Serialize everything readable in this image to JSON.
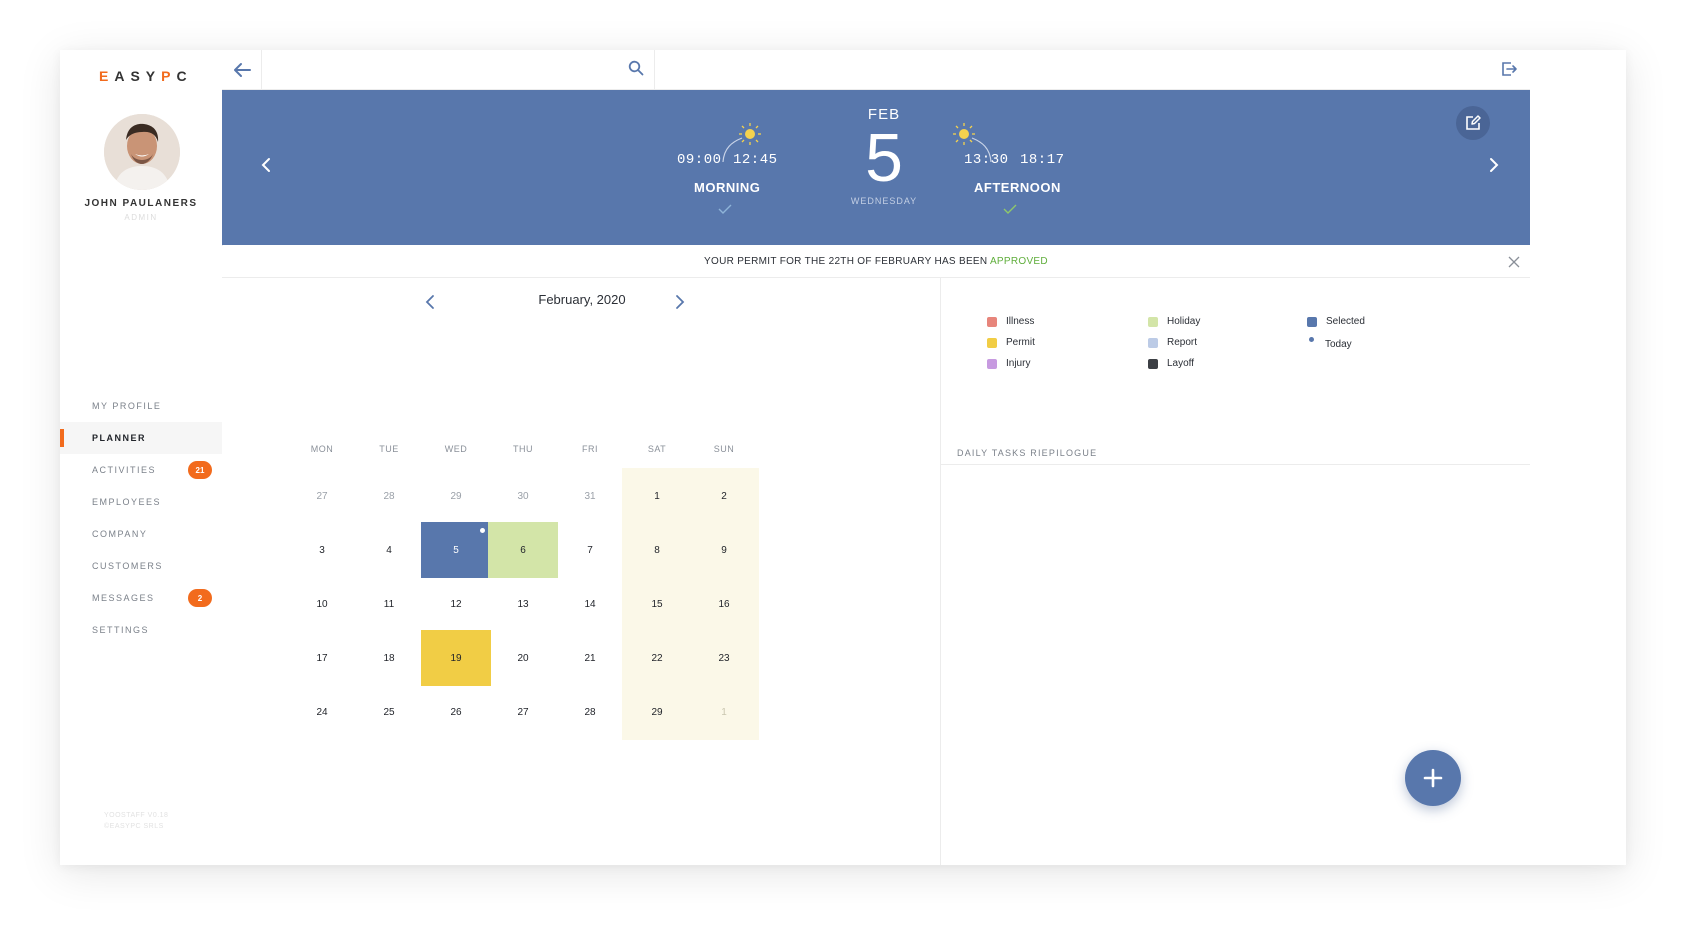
{
  "brand": {
    "logo_prefix": "E",
    "logo_text": "ASY",
    "logo_accent": "P",
    "logo_suffix": "C",
    "accent_color": "#f26b1d"
  },
  "user": {
    "name": "JOHN PAULANERS",
    "role": "ADMIN"
  },
  "nav": [
    {
      "label": "MY PROFILE",
      "badge": ""
    },
    {
      "label": "PLANNER",
      "badge": "",
      "active": true
    },
    {
      "label": "ACTIVITIES",
      "badge": "21"
    },
    {
      "label": "EMPLOYEES",
      "badge": ""
    },
    {
      "label": "COMPANY",
      "badge": ""
    },
    {
      "label": "CUSTOMERS",
      "badge": ""
    },
    {
      "label": "MESSAGES",
      "badge": "2"
    },
    {
      "label": "SETTINGS",
      "badge": ""
    }
  ],
  "version": {
    "line1": "YOOSTAFF V0.18",
    "line2": "©EASYPC SRLS"
  },
  "search": {
    "placeholder": "",
    "value": ""
  },
  "banner": {
    "month": "FEB",
    "day": "5",
    "weekday": "WEDNESDAY",
    "morning": {
      "start": "09:00",
      "end": "12:45",
      "label": "MORNING",
      "icon": "sun-icon"
    },
    "afternoon": {
      "start": "13:30",
      "end": "18:17",
      "label": "AFTERNOON",
      "icon": "sun-icon"
    },
    "color": "#5877ac"
  },
  "notice": {
    "text": "YOUR PERMIT FOR THE 22TH OF FEBRUARY HAS BEEN ",
    "status": "APPROVED",
    "status_color": "#5fae3b"
  },
  "calendar": {
    "title": "February, 2020",
    "weekdays": [
      "MON",
      "TUE",
      "WED",
      "THU",
      "FRI",
      "SAT",
      "SUN"
    ],
    "weeks": [
      [
        {
          "d": "27",
          "t": "muted"
        },
        {
          "d": "28",
          "t": "muted"
        },
        {
          "d": "29",
          "t": "muted"
        },
        {
          "d": "30",
          "t": "muted"
        },
        {
          "d": "31",
          "t": "muted"
        },
        {
          "d": "1",
          "t": "weekend"
        },
        {
          "d": "2",
          "t": "weekend"
        }
      ],
      [
        {
          "d": "3"
        },
        {
          "d": "4"
        },
        {
          "d": "5",
          "t": "selected",
          "today": true
        },
        {
          "d": "6",
          "t": "holiday"
        },
        {
          "d": "7"
        },
        {
          "d": "8",
          "t": "weekend"
        },
        {
          "d": "9",
          "t": "weekend"
        }
      ],
      [
        {
          "d": "10"
        },
        {
          "d": "11"
        },
        {
          "d": "12"
        },
        {
          "d": "13"
        },
        {
          "d": "14"
        },
        {
          "d": "15",
          "t": "weekend"
        },
        {
          "d": "16",
          "t": "weekend"
        }
      ],
      [
        {
          "d": "17"
        },
        {
          "d": "18"
        },
        {
          "d": "19",
          "t": "permit"
        },
        {
          "d": "20"
        },
        {
          "d": "21"
        },
        {
          "d": "22",
          "t": "weekend"
        },
        {
          "d": "23",
          "t": "weekend"
        }
      ],
      [
        {
          "d": "24"
        },
        {
          "d": "25"
        },
        {
          "d": "26"
        },
        {
          "d": "27"
        },
        {
          "d": "28"
        },
        {
          "d": "29",
          "t": "weekend"
        },
        {
          "d": "1",
          "t": "weekend muted"
        }
      ]
    ]
  },
  "legend": [
    {
      "label": "Illness",
      "color": "#e7857b"
    },
    {
      "label": "Permit",
      "color": "#f1cd45"
    },
    {
      "label": "Injury",
      "color": "#c79ae0"
    },
    {
      "label": "Holiday",
      "color": "#d3e5a8"
    },
    {
      "label": "Report",
      "color": "#bccbe6"
    },
    {
      "label": "Layoff",
      "color": "#3c3f44"
    },
    {
      "label": "Selected",
      "color": "#5877ac"
    },
    {
      "label": "Today",
      "color": "#5877ac",
      "dot": true
    }
  ],
  "tasks": {
    "header": "DAILY TASKS RIEPILOGUE"
  }
}
